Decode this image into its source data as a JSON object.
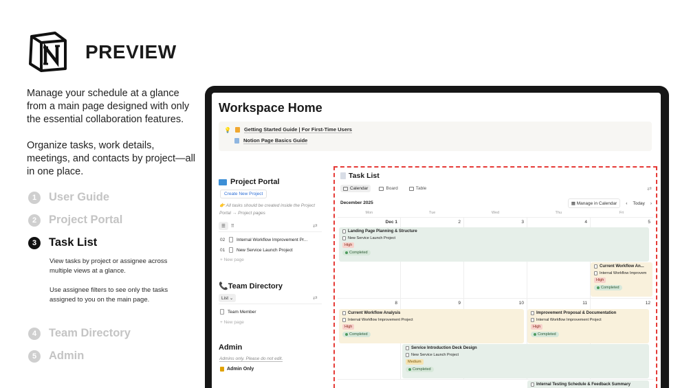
{
  "brand": {
    "logo": "notion-logo",
    "title": "PREVIEW"
  },
  "intro": {
    "p1": "Manage your schedule at a glance from a main page designed with only the essential collaboration features.",
    "p2": "Organize tasks, work details, meetings, and contacts by project—all in one place."
  },
  "steps": [
    {
      "num": "1",
      "label": "User Guide"
    },
    {
      "num": "2",
      "label": "Project Portal"
    },
    {
      "num": "3",
      "label": "Task List"
    },
    {
      "num": "4",
      "label": "Team Directory"
    },
    {
      "num": "5",
      "label": "Admin"
    }
  ],
  "active_step_desc": {
    "d1": "View tasks by project or assignee across multiple views at a glance.",
    "d2": "Use assignee filters to see only the tasks assigned to you on the main page."
  },
  "workspace": {
    "title": "Workspace Home",
    "callout": {
      "link1": "Getting Started Guide | For First-Time Users",
      "link2": "Notion Page Basics Guide"
    },
    "project_portal": {
      "title": "Project Portal",
      "button": "Create New Project",
      "note": "👉 All tasks should be created inside the Project Portal → Project pages",
      "view_glyph": "⠿",
      "rows": [
        {
          "n": "02",
          "label": "Internal Workflow Improvement Pr..."
        },
        {
          "n": "01",
          "label": "New Service Launch Project"
        }
      ],
      "new_page": "+ New page"
    },
    "team_directory": {
      "title": "📞Team Directory",
      "view": "List ⌄",
      "rows": [
        {
          "label": "Team Member"
        }
      ],
      "new_page": "+ New page"
    },
    "admin": {
      "title": "Admin",
      "note": "Admins only. Please do not edit.",
      "item": "Admin Only"
    },
    "task_list": {
      "title": "Task List",
      "tabs": [
        "Calendar",
        "Board",
        "Table"
      ],
      "month": "December 2025",
      "manage": "Manage in Calendar",
      "today": "Today",
      "weekdays": [
        "Mon",
        "Tue",
        "Wed",
        "Thu",
        "Fri"
      ],
      "week1": [
        "Dec 1",
        "2",
        "3",
        "4",
        "5"
      ],
      "week2": [
        "8",
        "9",
        "10",
        "11",
        "12"
      ],
      "cards": [
        {
          "title": "Landing Page Planning & Structure",
          "project": "New Service Launch Project",
          "priority": "High",
          "status": "Completed"
        },
        {
          "title": "Current Workflow An...",
          "project": "Internal Workflow Improvem",
          "priority": "High",
          "status": "Completed"
        },
        {
          "title": "Current Workflow Analysis",
          "project": "Internal Workflow Improvement Project",
          "priority": "High",
          "status": "Completed"
        },
        {
          "title": "Improvement Proposal & Documentation",
          "project": "Internal Workflow Improvement Project",
          "priority": "High",
          "status": "Completed"
        },
        {
          "title": "Service Introduction Deck Design",
          "project": "New Service Launch Project",
          "priority": "Medium",
          "status": "Completed"
        },
        {
          "title": "Internal Testing Schedule & Feedback Summary"
        }
      ]
    }
  },
  "colors": {
    "accent_red": "#e53935",
    "link_blue": "#2e6fd6",
    "card_green": "#e6efe9",
    "card_yellow": "#f9f1dc",
    "priority_high": "#f7d2cc",
    "status_completed": "#d7e8da"
  }
}
